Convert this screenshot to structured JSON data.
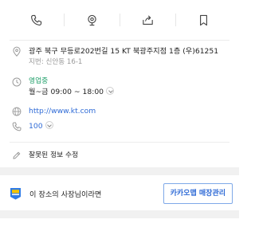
{
  "actions": [
    {
      "icon": "phone-icon"
    },
    {
      "icon": "route-pin-icon"
    },
    {
      "icon": "share-icon"
    },
    {
      "icon": "bookmark-icon"
    }
  ],
  "place": {
    "address": "광주 북구 무등로202번길 15 KT 북광주지점 1층 (우)61251",
    "lot_address": "지번: 신안동 16-1",
    "status": "영업중",
    "hours": "월~금 09:00 ~ 18:00",
    "website": "http://www.kt.com",
    "phone": "100"
  },
  "edit_label": "잘못된 정보 수정",
  "owner": {
    "prompt": "이 장소의 사장님이라면",
    "button_label": "카카오맵 매장관리"
  },
  "colors": {
    "link": "#2e6ad6",
    "open_status": "#22a06b",
    "owner_icon_blue": "#2f7be6",
    "owner_icon_yellow": "#f5c400"
  }
}
